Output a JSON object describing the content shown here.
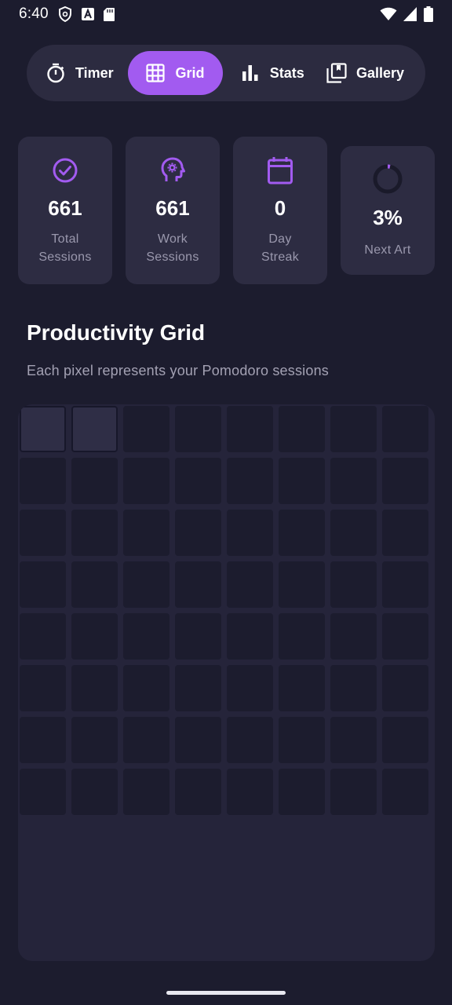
{
  "status_bar": {
    "time": "6:40",
    "left_icons": [
      "shield-icon",
      "a-letter-icon",
      "sd-card-icon"
    ],
    "right_icons": [
      "wifi-icon",
      "cellular-icon",
      "battery-icon"
    ]
  },
  "nav": {
    "items": [
      {
        "label": "Timer",
        "icon": "stopwatch-icon",
        "active": false
      },
      {
        "label": "Grid",
        "icon": "grid-icon",
        "active": true
      },
      {
        "label": "Stats",
        "icon": "bar-chart-icon",
        "active": false
      },
      {
        "label": "Gallery",
        "icon": "gallery-icon",
        "active": false
      }
    ],
    "active_color": "#a25bf0"
  },
  "stats": {
    "total": {
      "value": "661",
      "label_line1": "Total",
      "label_line2": "Sessions",
      "icon": "check-circle-icon"
    },
    "work": {
      "value": "661",
      "label_line1": "Work",
      "label_line2": "Sessions",
      "icon": "brain-gear-icon"
    },
    "streak": {
      "value": "0",
      "label_line1": "Day",
      "label_line2": "Streak",
      "icon": "calendar-icon"
    },
    "next_art": {
      "value": "3%",
      "label": "Next Art",
      "icon": "progress-ring-icon",
      "progress": 0.03
    }
  },
  "section": {
    "title": "Productivity Grid",
    "subtitle": "Each pixel represents your Pomodoro sessions"
  },
  "grid": {
    "columns": 8,
    "rows": 8,
    "filled_cells": 2
  },
  "colors": {
    "background": "#1c1c2e",
    "card": "#2d2c42",
    "accent": "#a25bf0",
    "muted_text": "#9a98ad"
  }
}
